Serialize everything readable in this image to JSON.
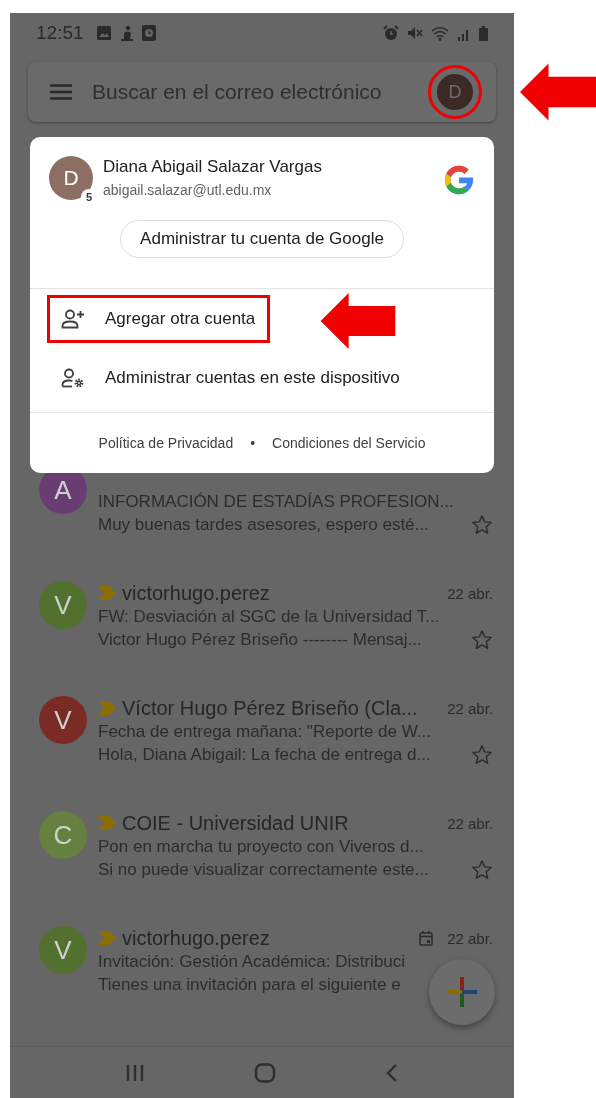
{
  "status_bar": {
    "time": "12:51"
  },
  "search_bar": {
    "placeholder": "Buscar en el correo electrónico",
    "avatar_letter": "D",
    "highlighted": true
  },
  "account_menu": {
    "name": "Diana Abigail Salazar Vargas",
    "email": "abigail.salazar@utl.edu.mx",
    "avatar_letter": "D",
    "badge": "5",
    "manage_button": "Administrar tu cuenta de Google",
    "items": [
      {
        "kind": "add-account",
        "label": "Agregar otra cuenta",
        "highlighted": true
      },
      {
        "kind": "manage-accounts",
        "label": "Administrar cuentas en este dispositivo",
        "highlighted": false
      }
    ],
    "footer": {
      "privacy": "Política de Privacidad",
      "separator": "•",
      "terms": "Condiciones del Servicio"
    }
  },
  "emails": [
    {
      "avatar_letter": "A",
      "color": "#6a3d72",
      "subject": "INFORMACIÓN DE ESTADÍAS PROFESION...",
      "snippet": "Muy buenas tardes asesores, espero esté...",
      "starred": false
    },
    {
      "avatar_letter": "V",
      "color": "#52702e",
      "important": true,
      "sender": "victorhugo.perez",
      "date": "22 abr.",
      "subject": "FW: Desviación al SGC de la Universidad T...",
      "snippet": "Victor Hugo Pérez Briseño -------- Mensaj...",
      "starred": false
    },
    {
      "avatar_letter": "V",
      "color": "#7a2b25",
      "important": true,
      "sender": "Víctor Hugo Pérez Briseño (Cla...",
      "date": "22 abr.",
      "subject": "Fecha de entrega mañana: \"Reporte de W...",
      "snippet": "Hola, Diana Abigail: La fecha de entrega d...",
      "starred": false
    },
    {
      "avatar_letter": "C",
      "color": "#66803f",
      "important": true,
      "sender": "COIE - Universidad UNIR",
      "date": "22 abr.",
      "subject": "Pon en marcha tu proyecto con Viveros d...",
      "snippet": "Si no puede visualizar correctamente este...",
      "starred": false
    },
    {
      "avatar_letter": "V",
      "color": "#52702e",
      "important": true,
      "has_event": true,
      "sender": "victorhugo.perez",
      "date": "22 abr.",
      "subject": "Invitación: Gestión Académica: Distribuci",
      "snippet": "Tienes una invitación para el siguiente e"
    }
  ]
}
